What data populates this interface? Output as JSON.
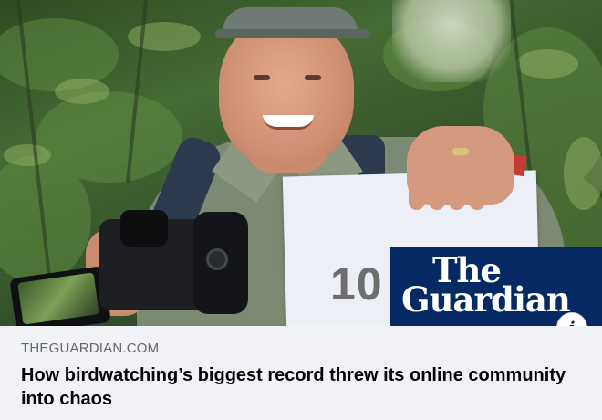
{
  "link_preview": {
    "domain": "THEGUARDIAN.COM",
    "headline": "How birdwatching’s biggest record threw its online community into chaos",
    "image": {
      "sign_number": "10",
      "brand_logo_line1": "The",
      "brand_logo_line2": "Guardian"
    },
    "info_icon_glyph": "i"
  },
  "colors": {
    "guardian_blue": "#052962",
    "card_background": "#f0f2f5",
    "domain_text": "#65676b",
    "headline_text": "#050505"
  },
  "icons": {
    "info": "info-icon"
  }
}
